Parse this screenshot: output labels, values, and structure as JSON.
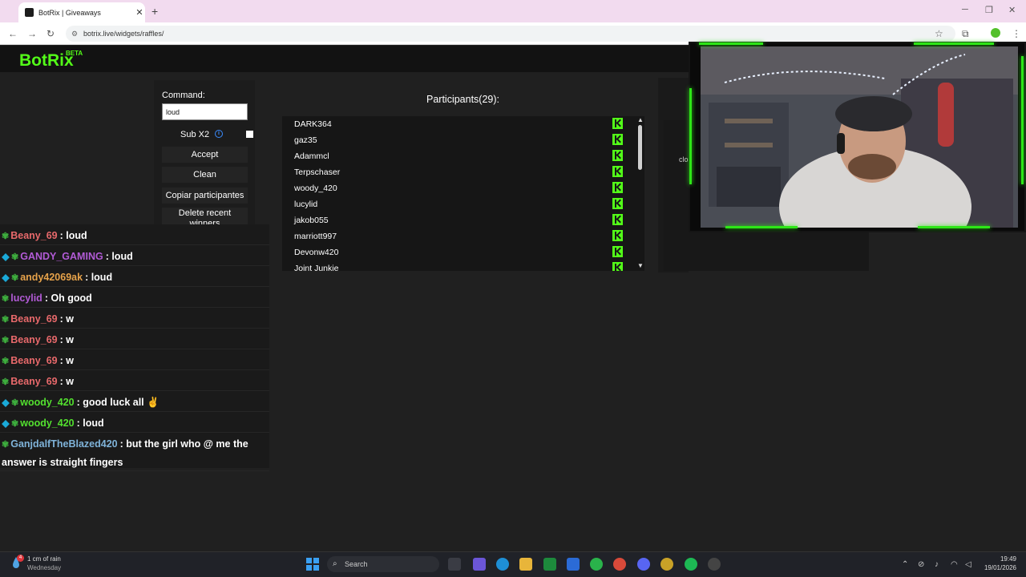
{
  "browser": {
    "tab_title": "BotRix | Giveaways",
    "tab_close": "✕",
    "new_tab": "+",
    "url": "botrix.live/widgets/raffles/"
  },
  "app": {
    "logo": "BotRix",
    "badge": "BETA",
    "brand_color": "#53fc18"
  },
  "controls": {
    "command_label": "Command:",
    "command_value": "loud",
    "sub_label": "Sub X2",
    "accept": "Accept",
    "clean": "Clean",
    "copy": "Copiar participantes",
    "delete_recent": "Delete recent winners"
  },
  "participants": {
    "title": "Participants(29):",
    "names": [
      "DARK364",
      "gaz35",
      "Adammcl",
      "Terpschaser",
      "woody_420",
      "lucylid",
      "jakob055",
      "marriott997",
      "Devonw420",
      "Joint Junkie"
    ]
  },
  "right_panel": {
    "partial_text": "clo"
  },
  "chat": {
    "messages": [
      {
        "user": "Beany_69",
        "text": ": loud",
        "color": "#e8696b",
        "badges": [
          "weed"
        ]
      },
      {
        "user": "GANDY_GAMING",
        "text": ": loud",
        "color": "#b25bd6",
        "badges": [
          "cube",
          "weed"
        ]
      },
      {
        "user": "andy42069ak",
        "text": ": loud",
        "color": "#e6a24a",
        "badges": [
          "cube",
          "weed"
        ]
      },
      {
        "user": "lucylid",
        "text": ": Oh good",
        "color": "#b25bd6",
        "badges": [
          "weed"
        ]
      },
      {
        "user": "Beany_69",
        "text": ": w",
        "color": "#e8696b",
        "badges": [
          "weed"
        ]
      },
      {
        "user": "Beany_69",
        "text": ": w",
        "color": "#e8696b",
        "badges": [
          "weed"
        ]
      },
      {
        "user": "Beany_69",
        "text": ": w",
        "color": "#e8696b",
        "badges": [
          "weed"
        ]
      },
      {
        "user": "Beany_69",
        "text": ": w",
        "color": "#e8696b",
        "badges": [
          "weed"
        ]
      },
      {
        "user": "woody_420",
        "text": ": good luck all ✌",
        "color": "#53e02f",
        "badges": [
          "cube",
          "weed"
        ]
      },
      {
        "user": "woody_420",
        "text": ": loud",
        "color": "#53e02f",
        "badges": [
          "cube",
          "weed"
        ]
      },
      {
        "user": "GanjdalfTheBlazed420",
        "text": ": but the girl who @ me the answer is straight fingers",
        "color": "#7fb3d9",
        "badges": [
          "weed"
        ]
      }
    ]
  },
  "taskbar": {
    "weather": "1 cm of rain",
    "weather_day": "Wednesday",
    "weather_badge": "4",
    "search": "Search",
    "time": "19:49",
    "date": "19/01/2026"
  }
}
